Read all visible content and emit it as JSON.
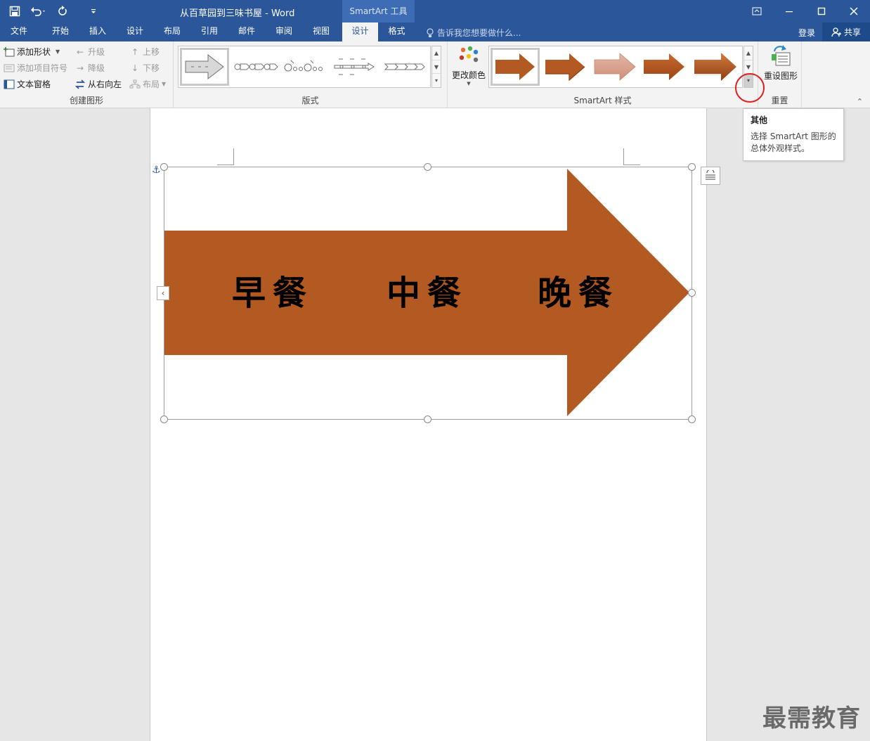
{
  "window": {
    "title": "从百草园到三味书屋 - Word",
    "context_tab_title": "SmartArt 工具"
  },
  "tabs": {
    "file": "文件",
    "home": "开始",
    "insert": "插入",
    "design1": "设计",
    "layout": "布局",
    "references": "引用",
    "mailings": "邮件",
    "review": "审阅",
    "view": "视图",
    "design_active": "设计",
    "format": "格式"
  },
  "tell_me": "告诉我您想要做什么...",
  "account": {
    "login": "登录",
    "share": "共享"
  },
  "ribbon": {
    "create_graphic": {
      "label": "创建图形",
      "add_shape": "添加形状",
      "add_bullet": "添加项目符号",
      "text_pane": "文本窗格",
      "promote": "升级",
      "demote": "降级",
      "right_to_left": "从右向左",
      "move_up": "上移",
      "move_down": "下移",
      "layout": "布局"
    },
    "layouts": {
      "label": "版式"
    },
    "styles": {
      "label": "SmartArt 样式",
      "change_colors": "更改颜色"
    },
    "reset": {
      "label": "重置",
      "reset_graphic": "重设图形"
    }
  },
  "tooltip": {
    "title": "其他",
    "body": "选择 SmartArt 图形的总体外观样式。"
  },
  "smartart": {
    "items": [
      "早餐",
      "中餐",
      "晚餐"
    ],
    "arrow_color": "#b35a22"
  },
  "watermark": "最需教育",
  "colors": {
    "accent": "#2b579a",
    "arrow": "#b35a22",
    "arrow_light": "#d9a08e",
    "highlight": "#e02020"
  }
}
